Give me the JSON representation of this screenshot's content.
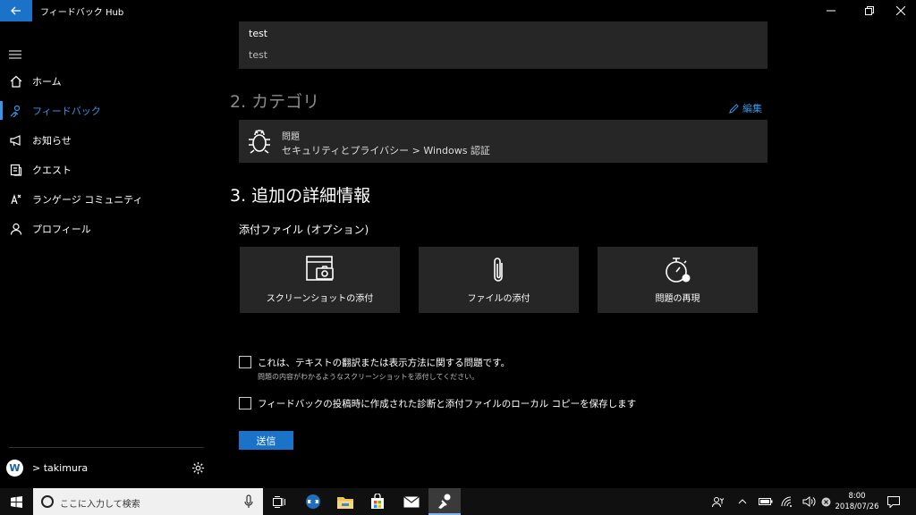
{
  "window": {
    "title": "フィードバック Hub"
  },
  "sidebar": {
    "items": [
      {
        "label": "ホーム",
        "icon": "home-icon"
      },
      {
        "label": "フィードバック",
        "icon": "feedback-icon",
        "active": true
      },
      {
        "label": "お知らせ",
        "icon": "megaphone-icon"
      },
      {
        "label": "クエスト",
        "icon": "quest-icon"
      },
      {
        "label": "ランゲージ コミュニティ",
        "icon": "language-icon"
      },
      {
        "label": "プロフィール",
        "icon": "person-icon"
      }
    ],
    "user": {
      "avatar_letter": "W",
      "name": "> takimura"
    }
  },
  "summary": {
    "title": "test",
    "description": "test"
  },
  "category_section": {
    "heading": "2. カテゴリ",
    "edit_label": "編集",
    "type": "問題",
    "path": "セキュリティとプライバシー > Windows 認証"
  },
  "details_section": {
    "heading": "3. 追加の詳細情報",
    "attachments_heading": "添付ファイル (オプション)",
    "buttons": [
      {
        "label": "スクリーンショットの添付",
        "icon": "screenshot-icon"
      },
      {
        "label": "ファイルの添付",
        "icon": "paperclip-icon"
      },
      {
        "label": "問題の再現",
        "icon": "stopwatch-icon"
      }
    ],
    "checkbox_translation": {
      "label": "これは、テキストの翻訳または表示方法に関する問題です。",
      "sublabel": "問題の内容がわかるようなスクリーンショットを添付してください。"
    },
    "checkbox_save_copy": {
      "label": "フィードバックの投稿時に作成された診断と添付ファイルのローカル コピーを保存します"
    },
    "submit_label": "送信"
  },
  "taskbar": {
    "search_placeholder": "ここに入力して検索",
    "time": "8:00",
    "date": "2018/07/26"
  },
  "colors": {
    "accent": "#1a73c8",
    "accent_text": "#3a95e6",
    "card_bg": "#262626"
  }
}
